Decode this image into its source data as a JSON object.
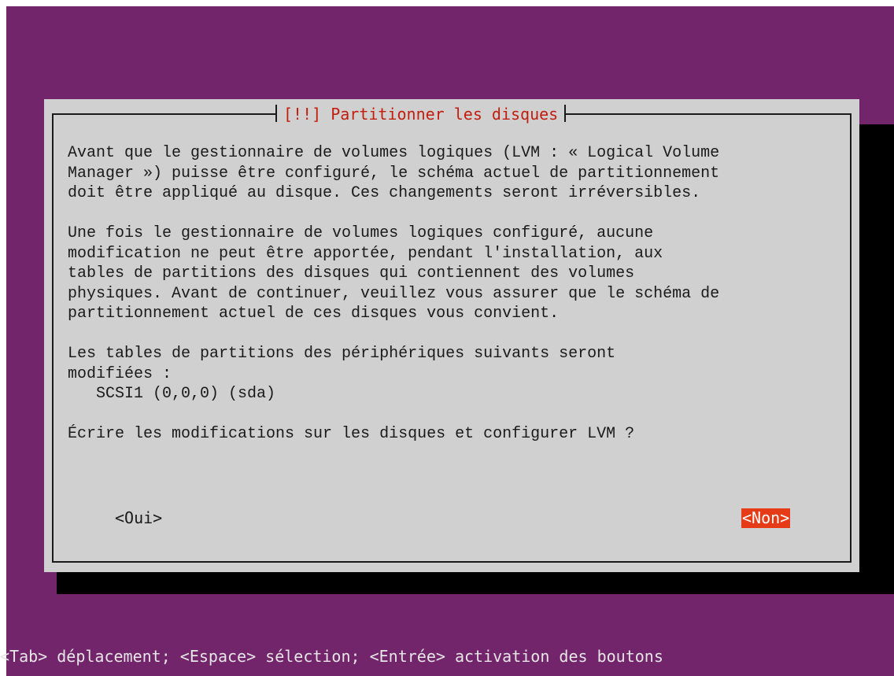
{
  "installer": {
    "dialog": {
      "title": "[!!] Partitionner les disques",
      "body": "Avant que le gestionnaire de volumes logiques (LVM : « Logical Volume\nManager ») puisse être configuré, le schéma actuel de partitionnement\ndoit être appliqué au disque. Ces changements seront irréversibles.\n\nUne fois le gestionnaire de volumes logiques configuré, aucune\nmodification ne peut être apportée, pendant l'installation, aux\ntables de partitions des disques qui contiennent des volumes\nphysiques. Avant de continuer, veuillez vous assurer que le schéma de\npartitionnement actuel de ces disques vous convient.\n\nLes tables de partitions des périphériques suivants seront\nmodifiées :\n   SCSI1 (0,0,0) (sda)\n\nÉcrire les modifications sur les disques et configurer LVM ?",
      "buttons": {
        "yes_label": "<Oui>",
        "no_label": "<Non>",
        "selected": "no"
      }
    },
    "hint_bar": "<Tab> déplacement; <Espace> sélection; <Entrée> activation des boutons"
  },
  "colors": {
    "background": "#73256b",
    "dialog": "#d0d0d0",
    "title_text": "#c21d0d",
    "selected_button": "#e53b17",
    "shadow": "#000000"
  }
}
